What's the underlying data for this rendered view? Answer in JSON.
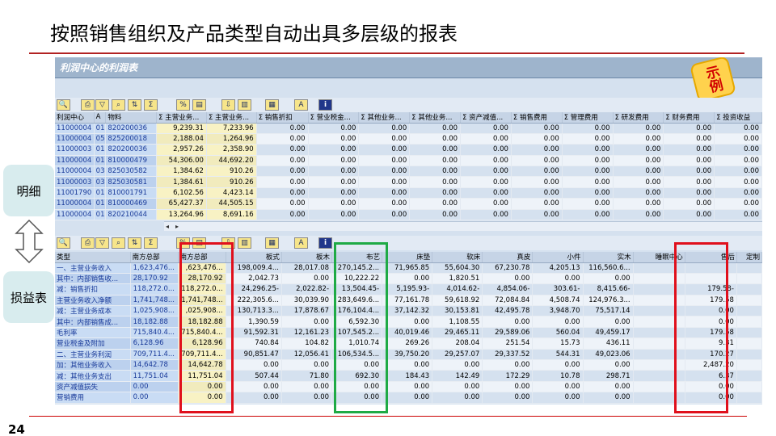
{
  "slide": {
    "title": "按照销售组织及产品类型自动出具多层级的报表",
    "page_number": "24",
    "labels": {
      "detail": "明细",
      "pl_statement": "损益表"
    },
    "accent_color": "#b22222"
  },
  "sap": {
    "window_title": "利润中心的利润表",
    "stamp": "示例",
    "toolbar_icons": [
      "detail-icon",
      "print-icon",
      "filter-icon",
      "find-icon",
      "sort-icon",
      "sum-icon",
      "subtotal-icon",
      "layout-icon",
      "export-icon",
      "graph-icon",
      "view-icon",
      "abc-icon",
      "info-icon"
    ],
    "detail_table": {
      "columns": [
        "利润中心",
        "A",
        "物料",
        "Σ 主营业务...",
        "Σ 主营业务...",
        "Σ 销售折扣",
        "Σ 营业税金...",
        "Σ 其他业务...",
        "Σ 其他业务...",
        "Σ 资产减值...",
        "Σ 销售费用",
        "Σ 管理费用",
        "Σ 研发费用",
        "Σ 财务费用",
        "Σ 投资收益",
        "Σ"
      ],
      "rows": [
        [
          "11000004",
          "01",
          "820200036",
          "9,239.31",
          "7,233.96",
          "0.00",
          "0.00",
          "0.00",
          "0.00",
          "0.00",
          "0.00",
          "0.00",
          "0.00",
          "0.00",
          "0.00"
        ],
        [
          "11000004",
          "05",
          "825200018",
          "2,188.04",
          "1,264.96",
          "0.00",
          "0.00",
          "0.00",
          "0.00",
          "0.00",
          "0.00",
          "0.00",
          "0.00",
          "0.00",
          "0.00"
        ],
        [
          "11000003",
          "01",
          "820200036",
          "2,957.26",
          "2,358.90",
          "0.00",
          "0.00",
          "0.00",
          "0.00",
          "0.00",
          "0.00",
          "0.00",
          "0.00",
          "0.00",
          "0.00"
        ],
        [
          "11000004",
          "01",
          "810000479",
          "54,306.00",
          "44,692.20",
          "0.00",
          "0.00",
          "0.00",
          "0.00",
          "0.00",
          "0.00",
          "0.00",
          "0.00",
          "0.00",
          "0.00"
        ],
        [
          "11000004",
          "03",
          "825030582",
          "1,384.62",
          "910.26",
          "0.00",
          "0.00",
          "0.00",
          "0.00",
          "0.00",
          "0.00",
          "0.00",
          "0.00",
          "0.00",
          "0.00"
        ],
        [
          "11000003",
          "03",
          "825030581",
          "1,384.61",
          "910.26",
          "0.00",
          "0.00",
          "0.00",
          "0.00",
          "0.00",
          "0.00",
          "0.00",
          "0.00",
          "0.00",
          "0.00"
        ],
        [
          "11001790",
          "01",
          "810001791",
          "6,102.56",
          "4,423.14",
          "0.00",
          "0.00",
          "0.00",
          "0.00",
          "0.00",
          "0.00",
          "0.00",
          "0.00",
          "0.00",
          "0.00"
        ],
        [
          "11000004",
          "01",
          "810000469",
          "65,427.37",
          "44,505.15",
          "0.00",
          "0.00",
          "0.00",
          "0.00",
          "0.00",
          "0.00",
          "0.00",
          "0.00",
          "0.00",
          "0.00"
        ],
        [
          "11000004",
          "01",
          "820210044",
          "13,264.96",
          "8,691.16",
          "0.00",
          "0.00",
          "0.00",
          "0.00",
          "0.00",
          "0.00",
          "0.00",
          "0.00",
          "0.00",
          "0.00"
        ]
      ]
    },
    "summary_table": {
      "columns": [
        "类型",
        "南方总部",
        "南方总部",
        "板式",
        "板木",
        "布艺",
        "床垫",
        "软床",
        "真皮",
        "小件",
        "实木",
        "睡眠中心",
        "售后",
        "定制"
      ],
      "rows": [
        [
          "一、主营业务收入",
          "1,623,476...",
          ",623,476...",
          "198,009.4...",
          "28,017.08",
          "270,145.2...",
          "71,965.85",
          "55,604.30",
          "67,230.78",
          "4,205.13",
          "116,560.6...",
          "",
          "",
          ""
        ],
        [
          "其中：内部销售收...",
          "28,170.92",
          "28,170.92",
          "2,042.73",
          "0.00",
          "10,222.22",
          "0.00",
          "1,820.51",
          "0.00",
          "0.00",
          "0.00",
          "",
          "",
          ""
        ],
        [
          "减：销售折扣",
          "118,272.0...",
          "118,272.0...",
          "24,296.25-",
          "2,022.82-",
          "13,504.45-",
          "5,195.93-",
          "4,014.62-",
          "4,854.06-",
          "303.61-",
          "8,415.66-",
          "",
          "179.58-",
          ""
        ],
        [
          "主营业务收入净额",
          "1,741,748...",
          "1,741,748...",
          "222,305.6...",
          "30,039.90",
          "283,649.6...",
          "77,161.78",
          "59,618.92",
          "72,084.84",
          "4,508.74",
          "124,976.3...",
          "",
          "179.58",
          ""
        ],
        [
          "减：主营业务成本",
          "1,025,908...",
          ",025,908...",
          "130,713.3...",
          "17,878.67",
          "176,104.4...",
          "37,142.32",
          "30,153.81",
          "42,495.78",
          "3,948.70",
          "75,517.14",
          "",
          "0.00",
          ""
        ],
        [
          "其中：内部销售成...",
          "18,182.88",
          "18,182.88",
          "1,390.59",
          "0.00",
          "6,592.30",
          "0.00",
          "1,108.55",
          "0.00",
          "0.00",
          "0.00",
          "",
          "0.00",
          ""
        ],
        [
          "毛利率",
          "715,840.4...",
          "715,840.4...",
          "91,592.31",
          "12,161.23",
          "107,545.2...",
          "40,019.46",
          "29,465.11",
          "29,589.06",
          "560.04",
          "49,459.17",
          "",
          "179.58",
          ""
        ],
        [
          "营业税金及附加",
          "6,128.96",
          "6,128.96",
          "740.84",
          "104.82",
          "1,010.74",
          "269.26",
          "208.04",
          "251.54",
          "15.73",
          "436.11",
          "",
          "9.31",
          ""
        ],
        [
          "二、主营业务利润",
          "709,711.4...",
          "709,711.4...",
          "90,851.47",
          "12,056.41",
          "106,534.5...",
          "39,750.20",
          "29,257.07",
          "29,337.52",
          "544.31",
          "49,023.06",
          "",
          "170.27",
          ""
        ],
        [
          "加：其他业务收入",
          "14,642.78",
          "14,642.78",
          "0.00",
          "0.00",
          "0.00",
          "0.00",
          "0.00",
          "0.00",
          "0.00",
          "0.00",
          "",
          "2,487.20",
          ""
        ],
        [
          "减：其他业务支出",
          "11,751.04",
          "11,751.04",
          "507.44",
          "71.80",
          "692.30",
          "184.43",
          "142.49",
          "172.29",
          "10.78",
          "298.71",
          "",
          "6.37",
          ""
        ],
        [
          "资产减值损失",
          "0.00",
          "0.00",
          "0.00",
          "0.00",
          "0.00",
          "0.00",
          "0.00",
          "0.00",
          "0.00",
          "0.00",
          "",
          "0.00",
          ""
        ],
        [
          "营销费用",
          "0.00",
          "0.00",
          "0.00",
          "0.00",
          "0.00",
          "0.00",
          "0.00",
          "0.00",
          "0.00",
          "0.00",
          "",
          "0.00",
          ""
        ]
      ]
    },
    "highlight_colors": {
      "red": "#e0101c",
      "green": "#1faa45"
    }
  }
}
